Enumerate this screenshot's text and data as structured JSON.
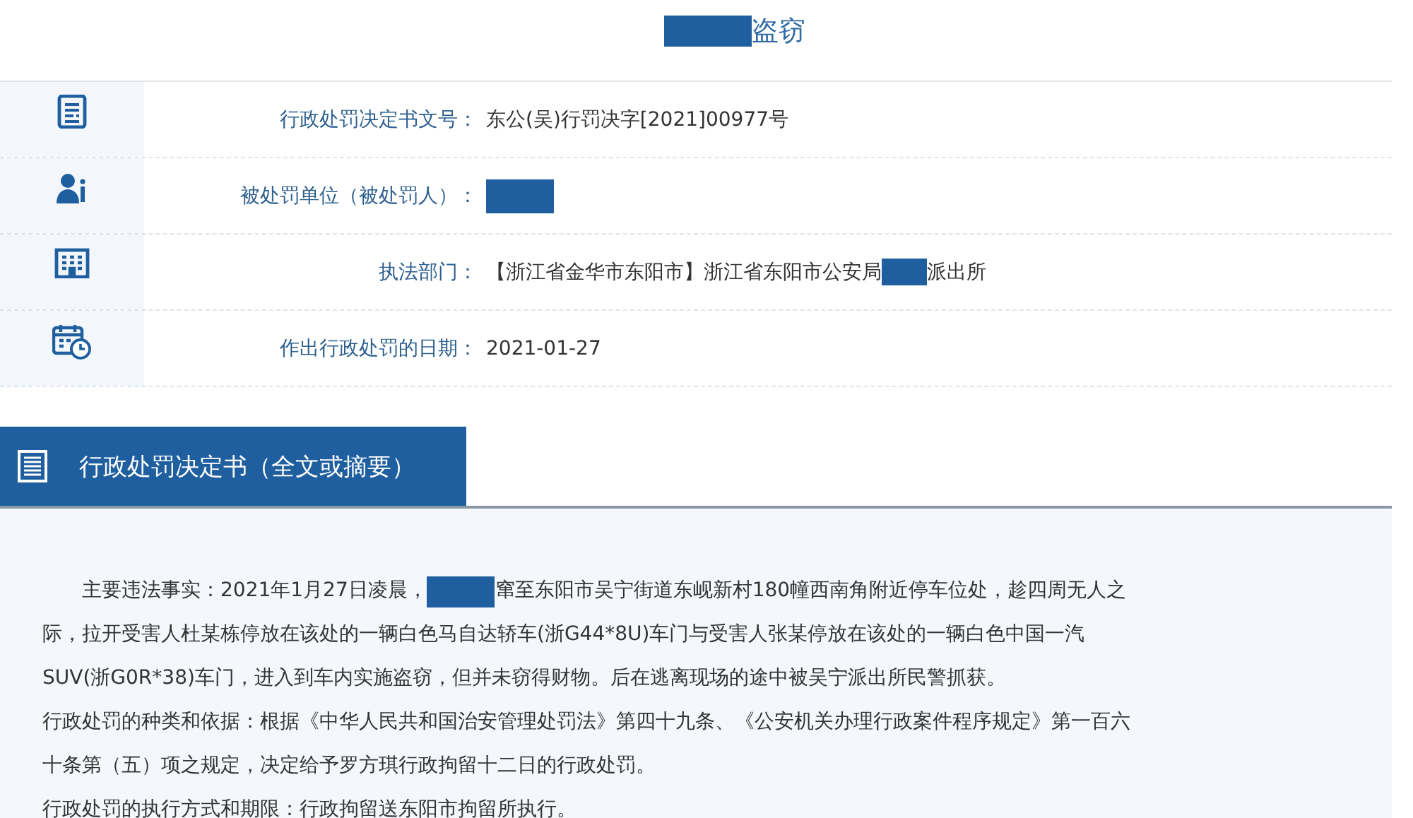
{
  "title": [
    {
      "kind": "redaction"
    },
    {
      "kind": "text",
      "text": "盗窃"
    }
  ],
  "info_rows": [
    {
      "label": "行政处罚决定书文号：",
      "value": [
        {
          "kind": "text",
          "text": "东公(吴)行罚决字[2021]00977号"
        }
      ]
    },
    {
      "label": "被处罚单位（被处罚人）：",
      "value": [
        {
          "kind": "redaction"
        }
      ]
    },
    {
      "label": "执法部门：",
      "value": [
        {
          "kind": "text",
          "text": "【浙江省金华市东阳市】浙江省东阳市公安局"
        },
        {
          "kind": "redaction"
        },
        {
          "kind": "text",
          "text": "派出所"
        }
      ]
    },
    {
      "label": "作出行政处罚的日期：",
      "value": [
        {
          "kind": "text",
          "text": "2021-01-27"
        }
      ]
    }
  ],
  "section": {
    "title": "行政处罚决定书（全文或摘要）"
  },
  "paragraphs": [
    {
      "indent": true,
      "lines": [
        [
          {
            "kind": "text",
            "text": "主要违法事实：2021年1月27日凌晨，"
          },
          {
            "kind": "redaction"
          },
          {
            "kind": "text",
            "text": "窜至东阳市吴宁街道东岘新村180幢西南角附近停车位处，趁四周无人之"
          }
        ],
        [
          {
            "kind": "text",
            "text": "际，拉开受害人杜某栋停放在该处的一辆白色马自达轿车(浙G44*8U)车门与受害人张某停放在该处的一辆白色中国一汽"
          }
        ],
        [
          {
            "kind": "text",
            "text": "SUV(浙G0R*38)车门，进入到车内实施盗窃，但并未窃得财物。后在逃离现场的途中被吴宁派出所民警抓获。"
          }
        ]
      ]
    },
    {
      "indent": false,
      "lines": [
        [
          {
            "kind": "text",
            "text": "行政处罚的种类和依据：根据《中华人民共和国治安管理处罚法》第四十九条、《公安机关办理行政案件程序规定》第一百六"
          }
        ],
        [
          {
            "kind": "text",
            "text": "十条第（五）项之规定，决定给予罗方琪行政拘留十二日的行政处罚。"
          }
        ]
      ]
    },
    {
      "indent": false,
      "lines": [
        [
          {
            "kind": "text",
            "text": "行政处罚的执行方式和期限：行政拘留送东阳市拘留所执行。"
          }
        ]
      ]
    }
  ]
}
